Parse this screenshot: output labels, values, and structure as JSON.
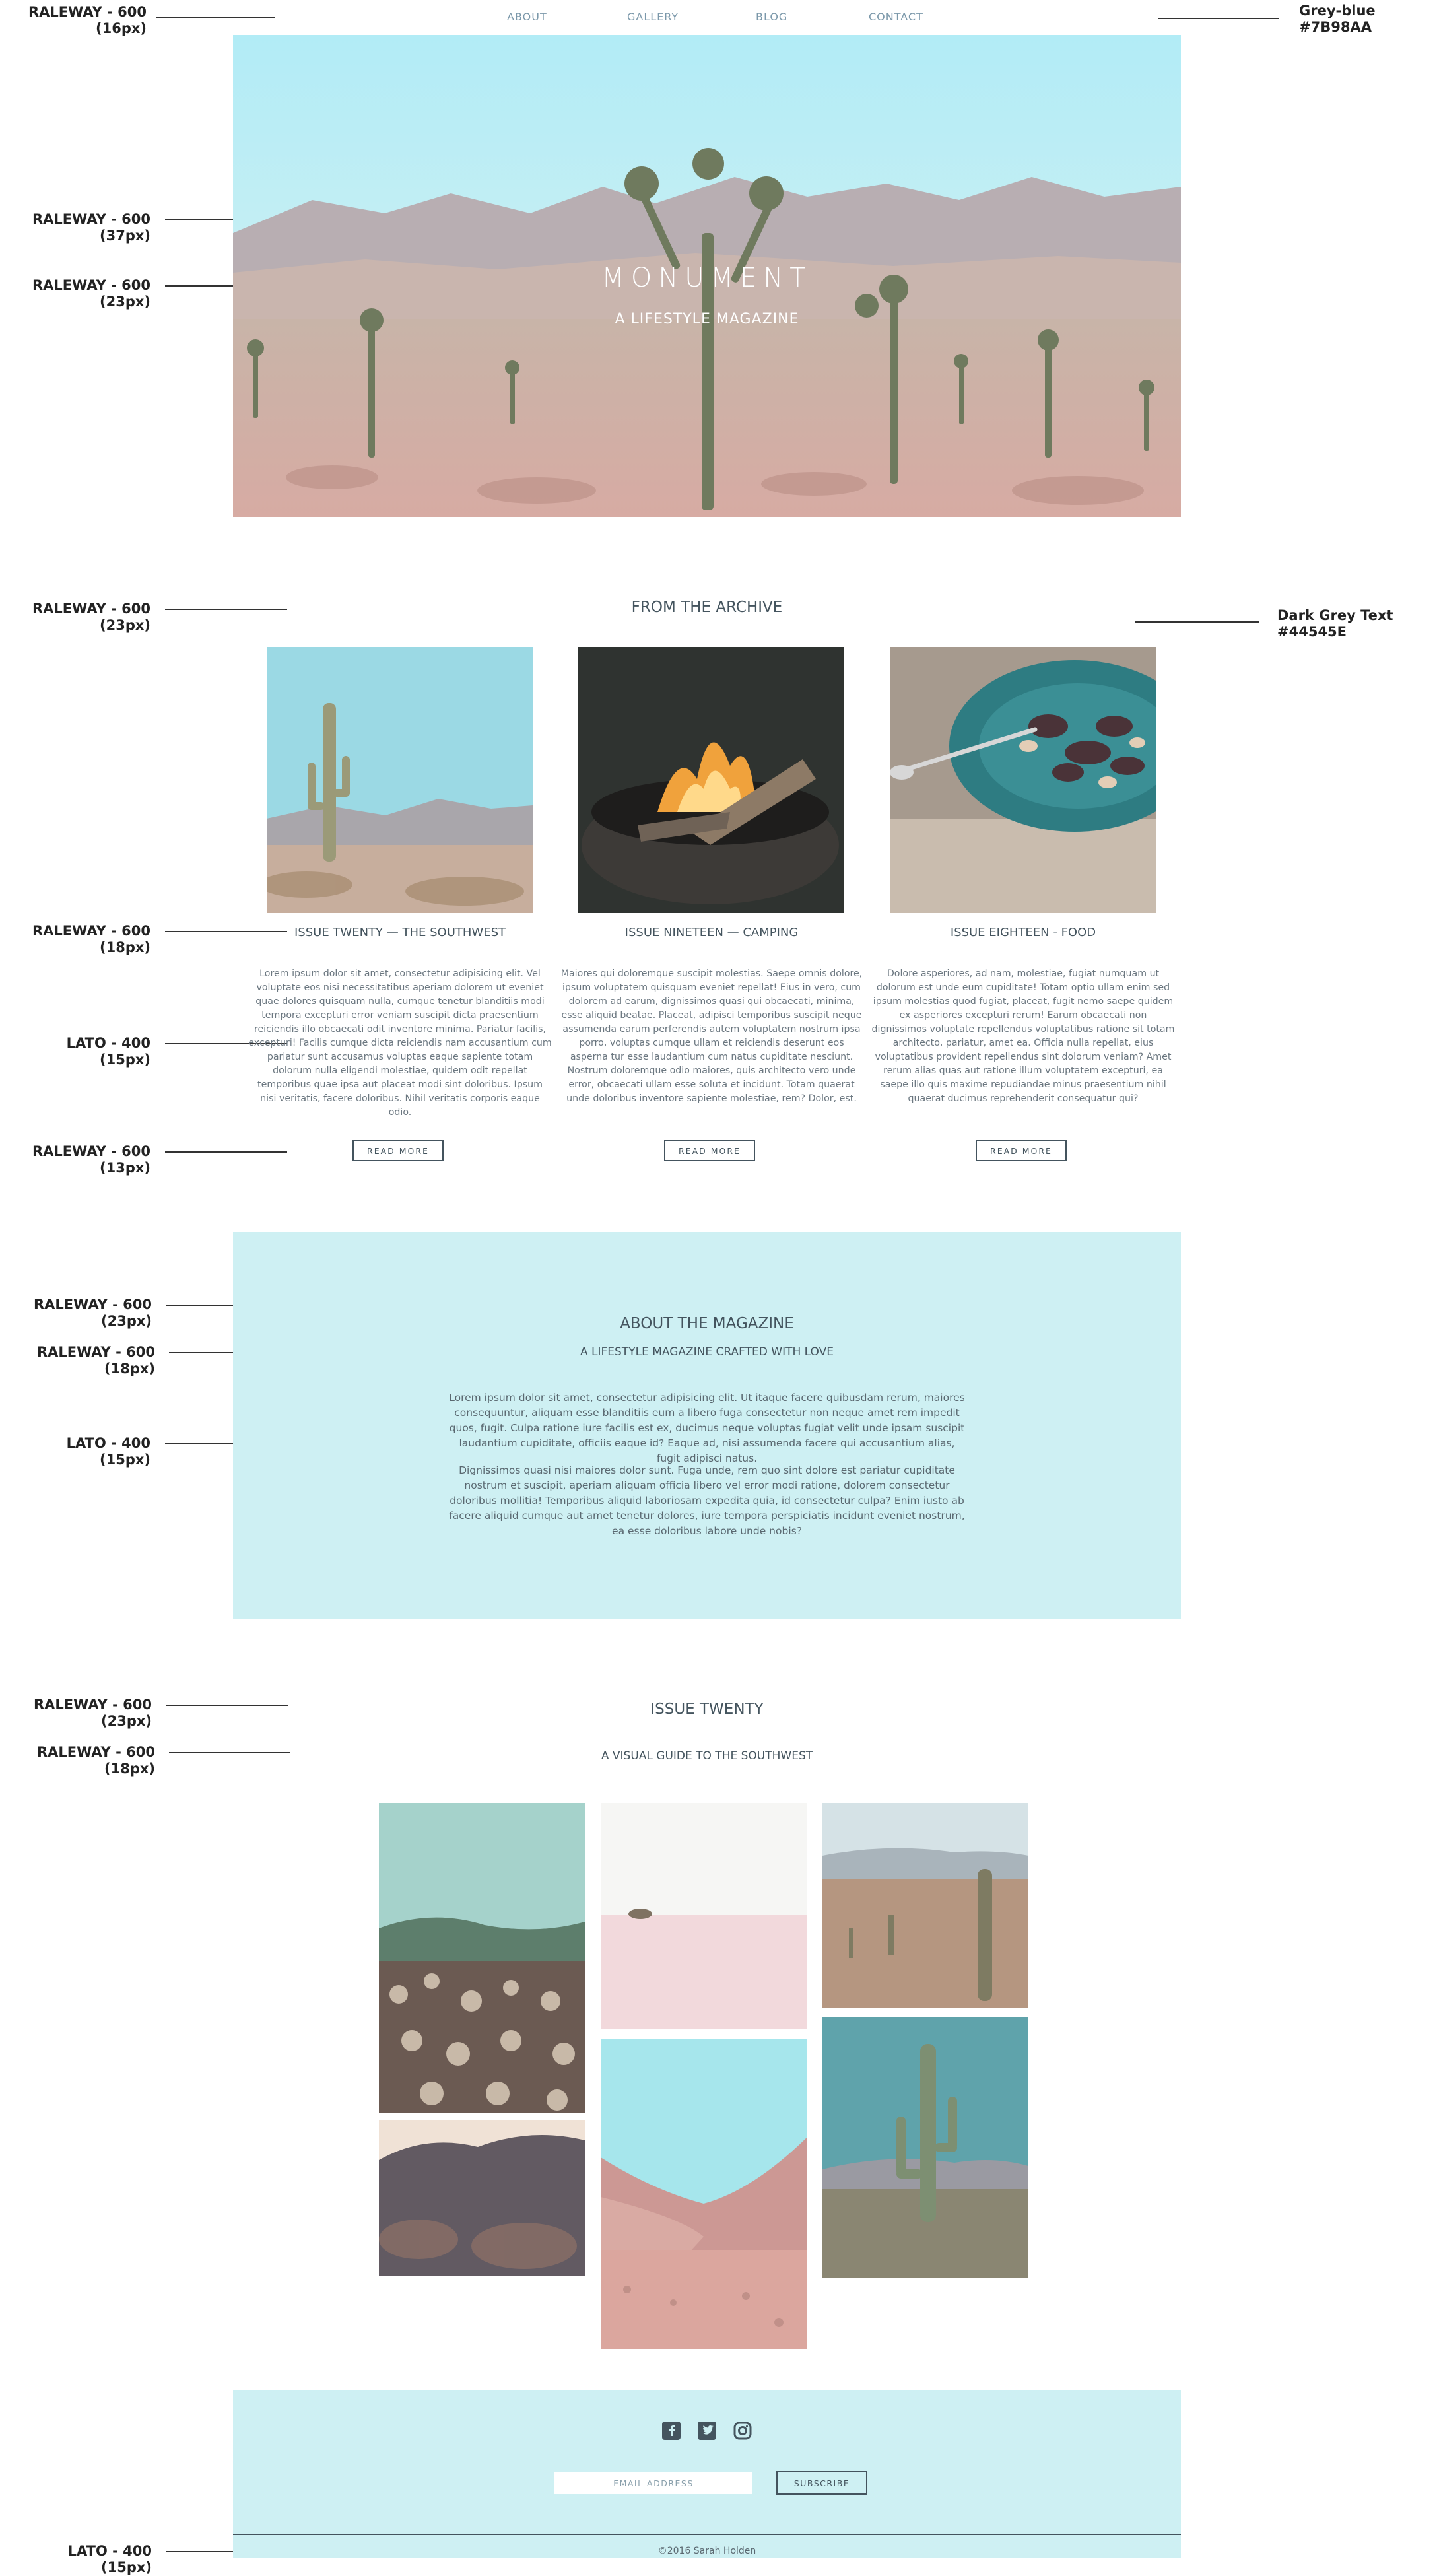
{
  "nav": {
    "items": [
      "ABOUT",
      "GALLERY",
      "BLOG",
      "CONTACT"
    ]
  },
  "annotations": {
    "nav_font": [
      "RALEWAY - 600",
      "(16px)"
    ],
    "nav_color": [
      "Grey-blue",
      "#7B98AA"
    ],
    "hero_title_font": [
      "RALEWAY - 600",
      "(37px)"
    ],
    "hero_sub_font": [
      "RALEWAY - 600",
      "(23px)"
    ],
    "archive_heading_font": [
      "RALEWAY - 600",
      "(23px)"
    ],
    "text_color": [
      "Dark Grey Text",
      "#44545E"
    ],
    "card_title_font": [
      "RALEWAY - 600",
      "(18px)"
    ],
    "card_body_font": [
      "LATO - 400",
      "(15px)"
    ],
    "button_font": [
      "RALEWAY - 600",
      "(13px)"
    ],
    "about_title_font": [
      "RALEWAY - 600",
      "(23px)"
    ],
    "about_sub_font": [
      "RALEWAY - 600",
      "(18px)"
    ],
    "about_body_font": [
      "LATO - 400",
      "(15px)"
    ],
    "issue_title_font": [
      "RALEWAY - 600",
      "(23px)"
    ],
    "issue_sub_font": [
      "RALEWAY - 600",
      "(18px)"
    ],
    "footer_font": [
      "LATO - 400",
      "(15px)"
    ]
  },
  "hero": {
    "title": "MONUMENT",
    "subtitle": "A LIFESTYLE MAGAZINE"
  },
  "archive": {
    "heading": "FROM THE ARCHIVE",
    "cards": [
      {
        "title": "ISSUE TWENTY — THE SOUTHWEST",
        "body": "Lorem ipsum dolor sit amet, consectetur adipisicing elit. Vel voluptate eos nisi necessitatibus aperiam dolorem ut eveniet quae dolores quisquam nulla, cumque tenetur blanditiis modi tempora excepturi error veniam suscipit dicta praesentium reiciendis illo obcaecati odit inventore minima. Pariatur facilis, excepturi! Facilis cumque dicta reiciendis nam accusantium cum pariatur sunt accusamus voluptas eaque sapiente totam dolorum nulla eligendi molestiae, quidem odit repellat temporibus quae ipsa aut placeat modi sint doloribus. Ipsum nisi veritatis, facere doloribus. Nihil veritatis corporis eaque odio.",
        "button": "READ MORE",
        "image": "saguaro-cactus-photo"
      },
      {
        "title": "ISSUE NINETEEN — CAMPING",
        "body": "Maiores qui doloremque suscipit molestias. Saepe omnis dolore, ipsum voluptatem quisquam eveniet repellat! Eius in vero, cum dolorem ad earum, dignissimos quasi qui obcaecati, minima, esse aliquid beatae. Placeat, adipisci temporibus suscipit neque assumenda earum perferendis autem voluptatem nostrum ipsa porro, voluptas cumque ullam et reiciendis deserunt eos asperna tur esse laudantium cum natus cupiditate nesciunt. Nostrum doloremque odio maiores, quis architecto vero unde error, obcaecati ullam esse soluta et incidunt. Totam quaerat unde doloribus inventore sapiente molestiae, rem? Dolor, est.",
        "button": "READ MORE",
        "image": "campfire-photo"
      },
      {
        "title": "ISSUE EIGHTEEN - FOOD",
        "body": "Dolore asperiores, ad nam, molestiae, fugiat numquam ut dolorum est unde eum cupiditate! Totam optio ullam enim sed ipsum molestias quod fugiat, placeat, fugit nemo saepe quidem ex asperiores excepturi rerum! Earum obcaecati non dignissimos voluptate repellendus voluptatibus ratione sit totam architecto, pariatur, amet ea. Officia nulla repellat, eius voluptatibus provident repellendus sint dolorum veniam? Amet rerum alias quas aut ratione illum voluptatem excepturi, ea saepe illo quis maxime repudiandae minus praesentium nihil quaerat ducimus reprehenderit consequatur qui?",
        "button": "READ MORE",
        "image": "food-plate-photo"
      }
    ]
  },
  "about": {
    "title": "ABOUT THE MAGAZINE",
    "subtitle": "A LIFESTYLE MAGAZINE CRAFTED WITH LOVE",
    "paragraph1": "Lorem ipsum dolor sit amet, consectetur adipisicing elit. Ut itaque facere quibusdam rerum, maiores consequuntur, aliquam esse blanditiis eum a libero fuga consectetur non neque amet rem impedit quos, fugit. Culpa ratione iure facilis est ex, ducimus neque voluptas fugiat velit unde ipsam suscipit laudantium cupiditate, officiis eaque id? Eaque ad, nisi assumenda facere qui accusantium alias, fugit adipisci natus.",
    "paragraph2": "Dignissimos quasi nisi maiores dolor sunt. Fuga unde, rem quo sint dolore est pariatur cupiditate nostrum et suscipit, aperiam aliquam officia libero vel error modi ratione, dolorem consectetur doloribus mollitia! Temporibus aliquid laboriosam expedita quia, id consectetur culpa? Enim iusto ab facere aliquid cumque aut amet tenetur dolores, iure tempora perspiciatis incidunt eveniet nostrum, ea esse doloribus labore unde nobis?"
  },
  "issue": {
    "title": "ISSUE TWENTY",
    "subtitle": "A VISUAL GUIDE TO THE SOUTHWEST"
  },
  "footer": {
    "social": [
      "facebook-icon",
      "twitter-icon",
      "instagram-icon"
    ],
    "email_placeholder": "EMAIL ADDRESS",
    "subscribe": "SUBSCRIBE",
    "copyright": "©2016 Sarah Holden"
  },
  "colors": {
    "grey_blue": "#7B98AA",
    "dark_grey_text": "#44545E",
    "light_aqua": "#CEF0F3"
  }
}
